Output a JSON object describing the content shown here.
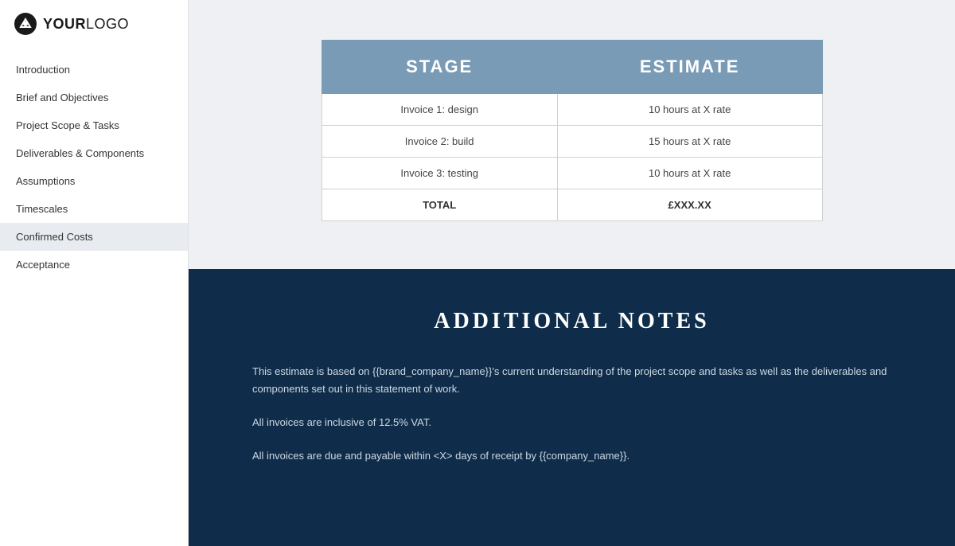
{
  "logo": {
    "icon_label": "logo-icon",
    "text_bold": "YOUR",
    "text_normal": "LOGO"
  },
  "sidebar": {
    "items": [
      {
        "label": "Introduction",
        "active": false
      },
      {
        "label": "Brief and Objectives",
        "active": false
      },
      {
        "label": "Project Scope & Tasks",
        "active": false
      },
      {
        "label": "Deliverables & Components",
        "active": false
      },
      {
        "label": "Assumptions",
        "active": false
      },
      {
        "label": "Timescales",
        "active": false
      },
      {
        "label": "Confirmed Costs",
        "active": true
      },
      {
        "label": "Acceptance",
        "active": false
      }
    ]
  },
  "table": {
    "col_stage": "STAGE",
    "col_estimate": "ESTIMATE",
    "rows": [
      {
        "stage": "Invoice 1: design",
        "estimate": "10 hours at X rate"
      },
      {
        "stage": "Invoice 2: build",
        "estimate": "15 hours at X rate"
      },
      {
        "stage": "Invoice 3: testing",
        "estimate": "10 hours at X rate"
      },
      {
        "stage": "TOTAL",
        "estimate": "£XXX.XX"
      }
    ]
  },
  "additional_notes": {
    "heading": "ADDITIONAL NOTES",
    "para1": "This estimate is based on {{brand_company_name}}'s current understanding of the project scope and tasks as well as the deliverables and components set out in this statement of work.",
    "para2": "All invoices are inclusive of 12.5% VAT.",
    "para3": "All invoices are due and payable within <X> days of receipt by {{company_name}}."
  }
}
